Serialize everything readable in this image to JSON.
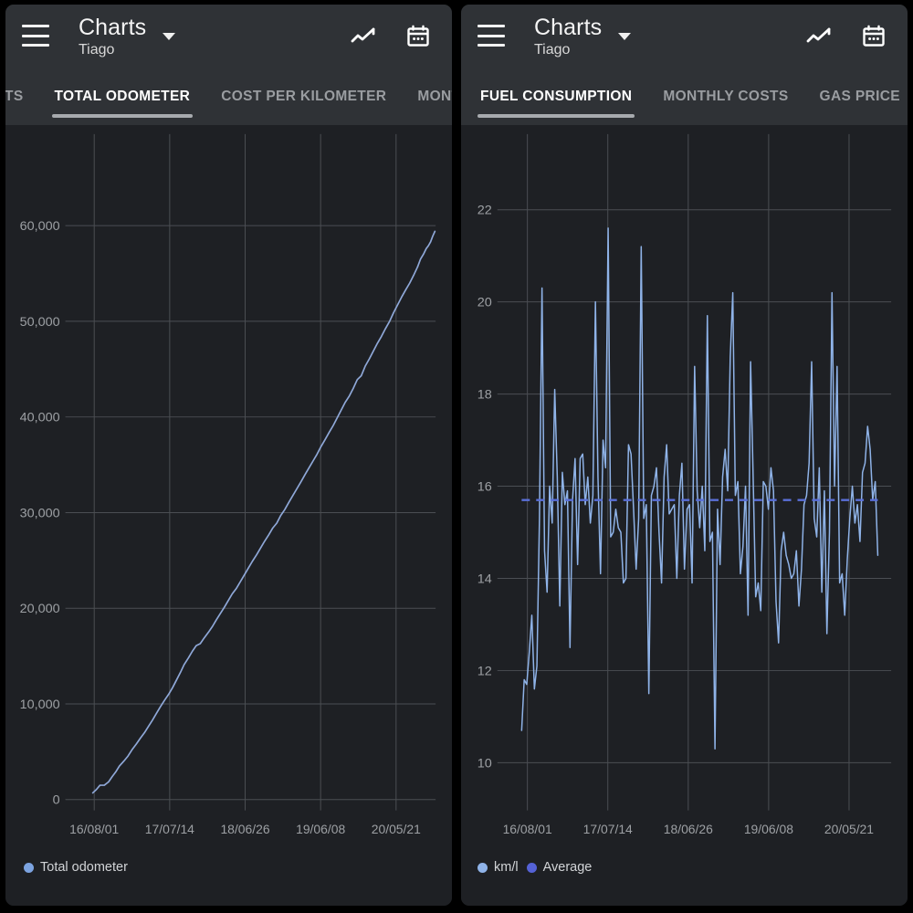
{
  "panels": [
    {
      "id": "left",
      "header": {
        "menu_icon": "hamburger-menu-icon",
        "title": "Charts",
        "subtitle": "Tiago",
        "dropdown_icon": "chevron-down-icon",
        "actions": [
          {
            "icon": "line-chart-icon",
            "name": "chart-type-button"
          },
          {
            "icon": "calendar-icon",
            "name": "date-range-button"
          }
        ]
      },
      "tabs": [
        {
          "label": "TS",
          "active": false,
          "clipped": true
        },
        {
          "label": "TOTAL ODOMETER",
          "active": true
        },
        {
          "label": "COST PER KILOMETER",
          "active": false
        },
        {
          "label": "MONTH",
          "active": false,
          "clipped": true
        }
      ],
      "legend": [
        {
          "label": "Total odometer",
          "color": "#7ca3e0"
        }
      ]
    },
    {
      "id": "right",
      "header": {
        "menu_icon": "hamburger-menu-icon",
        "title": "Charts",
        "subtitle": "Tiago",
        "dropdown_icon": "chevron-down-icon",
        "actions": [
          {
            "icon": "line-chart-icon",
            "name": "chart-type-button"
          },
          {
            "icon": "calendar-icon",
            "name": "date-range-button"
          }
        ]
      },
      "tabs": [
        {
          "label": "FUEL CONSUMPTION",
          "active": true
        },
        {
          "label": "MONTHLY COSTS",
          "active": false
        },
        {
          "label": "GAS PRICE",
          "active": false
        }
      ],
      "legend": [
        {
          "label": "km/l",
          "color": "#8fb3e8"
        },
        {
          "label": "Average",
          "color": "#5562d6"
        }
      ]
    }
  ],
  "colors": {
    "app_bar_bg": "#2f3236",
    "chart_bg": "#1e2024",
    "grid": "#4b4e53",
    "series_line": "#8fa8d8",
    "average_line": "#5a6fd8",
    "tab_active_text": "#ffffff",
    "tab_inactive_text": "#9a9da1",
    "axis_text": "#9da0a4"
  },
  "chart_data": [
    {
      "id": "total-odometer",
      "type": "line",
      "title": "Total odometer",
      "xlabel": "",
      "ylabel": "",
      "ylim": [
        0,
        66000
      ],
      "yticks": [
        0,
        10000,
        20000,
        30000,
        40000,
        50000,
        60000
      ],
      "ytick_labels": [
        "0",
        "10,000",
        "20,000",
        "30,000",
        "40,000",
        "50,000",
        "60,000"
      ],
      "xtick_labels": [
        "16/08/01",
        "17/07/14",
        "18/06/26",
        "19/06/08",
        "20/05/21"
      ],
      "xtick_fracs": [
        0.05,
        0.26,
        0.47,
        0.68,
        0.89
      ],
      "grid": true,
      "legend_position": "bottom-left",
      "series": [
        {
          "name": "Total odometer",
          "color": "#8fa8d8",
          "x": [
            0.046,
            0.056,
            0.066,
            0.078,
            0.09,
            0.1,
            0.11,
            0.12,
            0.132,
            0.144,
            0.155,
            0.167,
            0.178,
            0.19,
            0.2,
            0.212,
            0.223,
            0.234,
            0.246,
            0.257,
            0.268,
            0.279,
            0.29,
            0.3,
            0.312,
            0.323,
            0.334,
            0.345,
            0.356,
            0.368,
            0.379,
            0.39,
            0.4,
            0.412,
            0.423,
            0.434,
            0.446,
            0.457,
            0.468,
            0.479,
            0.49,
            0.502,
            0.513,
            0.524,
            0.536,
            0.547,
            0.558,
            0.569,
            0.58,
            0.592,
            0.603,
            0.614,
            0.625,
            0.637,
            0.648,
            0.659,
            0.67,
            0.681,
            0.692,
            0.704,
            0.715,
            0.726,
            0.737,
            0.748,
            0.76,
            0.771,
            0.782,
            0.793,
            0.804,
            0.816,
            0.827,
            0.838,
            0.849,
            0.86,
            0.872,
            0.883,
            0.894,
            0.905,
            0.917,
            0.928,
            0.94,
            0.95
          ],
          "y": [
            700,
            1050,
            1500,
            1500,
            1850,
            2400,
            2900,
            3500,
            4000,
            4550,
            5200,
            5800,
            6400,
            7000,
            7600,
            8300,
            9000,
            9700,
            10400,
            11000,
            11700,
            12500,
            13300,
            14100,
            14800,
            15500,
            16100,
            16300,
            16900,
            17500,
            18100,
            18800,
            19400,
            20100,
            20800,
            21500,
            22100,
            22800,
            23500,
            24200,
            24900,
            25600,
            26300,
            27000,
            27700,
            28400,
            28900,
            29700,
            30300,
            31100,
            31800,
            32500,
            33200,
            34000,
            34700,
            35400,
            36100,
            36900,
            37600,
            38400,
            39100,
            39900,
            40700,
            41500,
            42200,
            43000,
            43900,
            44300,
            45300,
            46100,
            46900,
            47700,
            48400,
            49200,
            50000,
            50900,
            51700,
            52500,
            53300,
            54000,
            54900,
            55700
          ]
        },
        {
          "name": "Total odometer (tail)",
          "color": "#8fa8d8",
          "x": [
            0.95,
            0.958,
            0.966,
            0.974,
            0.98,
            0.986,
            0.992,
            0.998
          ],
          "y": [
            55700,
            56500,
            57000,
            57600,
            57900,
            58300,
            58900,
            59400
          ]
        }
      ]
    },
    {
      "id": "fuel-consumption",
      "type": "line",
      "title": "Fuel consumption",
      "xlabel": "",
      "ylabel": "km/l",
      "ylim": [
        9.2,
        22.9
      ],
      "yticks": [
        10,
        12,
        14,
        16,
        18,
        20,
        22
      ],
      "ytick_labels": [
        "10",
        "12",
        "14",
        "16",
        "18",
        "20",
        "22"
      ],
      "xtick_labels": [
        "16/08/01",
        "17/07/14",
        "18/06/26",
        "19/06/08",
        "20/05/21"
      ],
      "xtick_fracs": [
        0.05,
        0.26,
        0.47,
        0.68,
        0.89
      ],
      "grid": true,
      "legend_position": "bottom-left",
      "average_value": 15.7,
      "series": [
        {
          "name": "km/l",
          "color": "#8fb3e8",
          "values": [
            10.7,
            11.8,
            11.7,
            12.4,
            13.2,
            11.6,
            12.1,
            15.3,
            20.3,
            14.6,
            13.7,
            16.0,
            15.2,
            18.1,
            16.2,
            13.4,
            16.3,
            15.6,
            15.9,
            12.5,
            15.7,
            16.6,
            14.3,
            16.6,
            16.7,
            15.6,
            16.2,
            15.2,
            15.8,
            20.0,
            16.2,
            14.1,
            17.0,
            16.4,
            21.6,
            14.9,
            15.0,
            15.5,
            15.1,
            15.0,
            13.9,
            14.0,
            16.9,
            16.7,
            15.5,
            14.2,
            15.3,
            21.2,
            15.3,
            15.6,
            11.5,
            15.8,
            16.0,
            16.4,
            15.0,
            13.9,
            16.2,
            16.9,
            15.4,
            15.5,
            15.6,
            14.0,
            15.8,
            16.5,
            14.2,
            15.5,
            15.6,
            13.9,
            18.6,
            15.9,
            15.1,
            16.0,
            14.6,
            19.7,
            14.8,
            15.0,
            10.3,
            15.5,
            14.3,
            16.2,
            16.8,
            15.9,
            18.8,
            20.2,
            15.8,
            16.1,
            14.1,
            14.7,
            16.0,
            13.2,
            18.7,
            16.2,
            13.6,
            13.9,
            13.3,
            16.1,
            16.0,
            15.5,
            16.4,
            15.9,
            13.5,
            12.6,
            14.6,
            15.0,
            14.5,
            14.3,
            14.0,
            14.1,
            14.6,
            13.4,
            14.2,
            15.6,
            15.8,
            16.5,
            18.7,
            15.3,
            14.9,
            16.4,
            13.7,
            15.9,
            12.8,
            15.0,
            20.2,
            16.0,
            18.6,
            13.9,
            14.1,
            13.2,
            14.4,
            15.3,
            16.0,
            15.2,
            15.6,
            14.8,
            16.3,
            16.5,
            17.3,
            16.8,
            15.7,
            16.1,
            14.5
          ]
        }
      ]
    }
  ]
}
